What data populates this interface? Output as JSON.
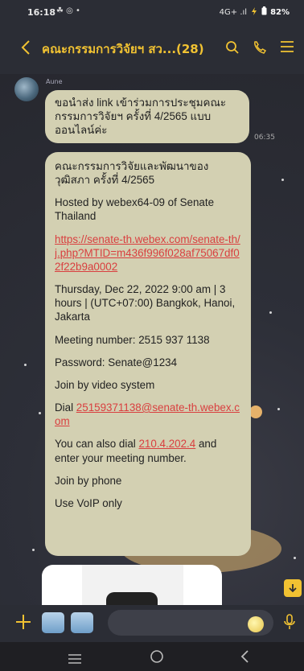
{
  "status_bar": {
    "time": "16:18",
    "left_icons": "☘ ◎ •",
    "network": "4G+ .ıl",
    "battery": "82%"
  },
  "header": {
    "title": "คณะกรรมการวิจัยฯ สว...(28)"
  },
  "chat": {
    "sender": "Aune",
    "message1": "ขอนำส่ง link เข้าร่วมการประชุมคณะกรรมการวิจัยฯ ครั้งที่ 4/2565 แบบออนไลน์ค่ะ",
    "time1": "06:35",
    "message2": {
      "title": "คณะกรรมการวิจัยและพัฒนาของวุฒิสภา ครั้งที่ 4/2565",
      "hosted": "Hosted by webex64-09 of  Senate Thailand",
      "link": "https://senate-th.webex.com/senate-th/j.php?MTID=m436f996f028af75067df02f22b9a0002",
      "datetime": "Thursday, Dec 22, 2022 9:00 am | 3 hours | (UTC+07:00) Bangkok, Hanoi, Jakarta",
      "meeting_number": "Meeting number: 2515 937 1138",
      "password": "Password: Senate@1234",
      "join_video": "Join by video system",
      "dial_prefix": "Dial ",
      "dial_link": "25159371138@senate-th.webex.com",
      "dial_also_prefix": "You can also dial ",
      "dial_also_ip": "210.4.202.4",
      "dial_also_suffix": " and enter your meeting number.",
      "join_phone": "Join by phone",
      "voip": "Use VoIP only"
    }
  },
  "colors": {
    "accent": "#f1c232",
    "bubble": "#d3d0b2",
    "link": "#d93f3f"
  }
}
